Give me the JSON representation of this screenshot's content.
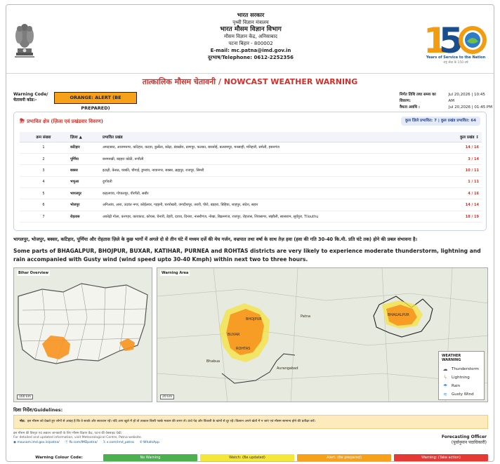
{
  "header": {
    "line1": "भारत सरकार",
    "line2": "पृथ्वी विज्ञान मंत्रालय",
    "line3": "भारत मौसम विज्ञान विभाग",
    "line4": "मौसम विज्ञान केंद्र, अनिसाबाद",
    "line5": "पटना बिहार - 800002",
    "line6": "E-mail: mc.patna@imd.gov.in",
    "line7": "दूरभाष/Telephone: 0612-2252356",
    "logo_number": "150",
    "logo_caption": "Years of Service to the Nation",
    "logo_caption_hi": "राष्ट्र सेवा के 150 वर्ष"
  },
  "title": "तात्कालिक मौसम चेतावनी / NOWCAST WEATHER WARNING",
  "warning": {
    "label_en": "Warning Code/",
    "label_hi": "चेतावनी कोड:-",
    "code": "ORANGE: ALERT (BE PREPARED)"
  },
  "issue": {
    "issued_label": "निर्गत तिथि तथा समय का विवरण:",
    "issued_value": "Jul 20,2026 | 10:45 AM",
    "valid_label": "वैधता अवधि :",
    "valid_value": "Jul 20,2026 | 01:45 PM"
  },
  "areas": {
    "heading": "प्रभावित क्षेत्र (ज़िला एवं प्रखंडवार विवरण)",
    "counts": "कुल ज़िले प्रभावित: 7 | कुल प्रखंड प्रभावित: 64",
    "columns": [
      "क्रम संख्या",
      "ज़िला ▲",
      "प्रभावित प्रखंड",
      "कुल प्रखंड ↕"
    ],
    "rows": [
      {
        "sn": "1",
        "district": "कटिहार",
        "blocks": "अमदाबाद, आजमनगर, कटिहार, कदवा, कुर्सेला, कोढ़ा, डंडखोरा, प्राणपुर, फलका, बारसोई, बलरामपुर, मनसाही, मनिहारी, समेली, हसनगंज",
        "total": "14 / 16"
      },
      {
        "sn": "2",
        "district": "पूर्णिया",
        "blocks": "बनमनखी, बड़हरा कोठी, रूपौली",
        "total": "3 / 14"
      },
      {
        "sn": "3",
        "district": "बक्सर",
        "blocks": "इटाढ़ी, केसठ, चक्की, चौगाई, डुमरांव, नावानगर, बक्सर, ब्रह्मपुर, राजपुर, सिमरी",
        "total": "10 / 11"
      },
      {
        "sn": "4",
        "district": "भभुआ",
        "blocks": "दुर्गावती",
        "total": "1 / 11"
      },
      {
        "sn": "5",
        "district": "भागलपुर",
        "blocks": "कहलगांव, गोपालपुर, पीरपैंती, सबौर",
        "total": "4 / 16"
      },
      {
        "sn": "6",
        "district": "भोजपुर",
        "blocks": "अगिआंव, आरा, उदवंत नगर, कोईलवर, गड़हनी, चरपोखरी, जगदीशपुर, तरारी, पीरो, बड़हरा, बिहिया, शाहपुर, संदेश, सहार",
        "total": "14 / 14"
      },
      {
        "sn": "7",
        "district": "रोहतास",
        "blocks": "अकोढ़ी गोला, करगहर, काराकाट, कोचस, चेनारी, डेहरी, दावथ, दिनारा, नासरीगंज, नोखा, बिक्रमगंज, राजपुर, रोहतास, शिवसागर, संझौली, सासाराम, सूर्यपुरा, Tilouthu",
        "total": "18 / 19"
      }
    ]
  },
  "message_hi": "भागलपुर, भोजपुर, बक्सर, कटिहार, पूर्णिया और रोहतास ज़िले के कुछ भागों में अगले दो से तीन घंटे में मध्यम दर्जे की मेघ गर्जन, वज्रपात तथा वर्षा के साथ तेज़ हवा (हवा की गति 30-40 कि.मी. प्रति घंटे तक) होने की प्रबल संभावना है।",
  "message_en": "Some parts of BHAGALPUR, BHOJPUR, BUXAR, KATIHAR, PURNEA and ROHTAS districts are very likely to experience moderate thunderstorm, lightning and rain accompanied with Gusty wind (wind speed upto 30-40 Kmph) within next two to three hours.",
  "maps": {
    "overview_title": "Bihar Overview",
    "overview_scale": "160 km",
    "area_title": "Warning Area",
    "area_scale": "20 km",
    "labels": [
      "BHOJPUR",
      "BUXAR",
      "ROHTAS",
      "BHAGALPUR",
      "Aurangabad",
      "Bhabua",
      "Patna"
    ],
    "legend_title": "WEATHER WARNING",
    "legend_items": [
      {
        "icon": "thunderstorm-icon",
        "label": "Thunderstorm"
      },
      {
        "icon": "lightning-icon",
        "label": "Lightning"
      },
      {
        "icon": "rain-icon",
        "label": "Rain"
      },
      {
        "icon": "gusty-wind-icon",
        "label": "Gusty Wind"
      }
    ]
  },
  "guidelines": {
    "heading": "दिशा निर्देश/Guidelines:",
    "note_label": "नोट:",
    "note": "इस मौसम को देखते हुए लोगों से आग्रह है कि वे सतर्क और सावधान रहें। यदि आप खुले में हों तो तत्काल किसी पक्के मकान की शरण लें। ऊंचे पेड़ और बिजली के खंभों से दूर रहें। किसान अपने खेतों में न जाएं एवं मौसम सामान्य होने की प्रतीक्षा करें।"
  },
  "footer": {
    "info_hi": "इस मौसम की विस्तृत एवं अद्यतन जानकारी के लिए मौसम विज्ञान केंद्र, पटना की वेबसाइट देखें।",
    "info_en": "For detailed and updated information, visit Meteorological Centre, Patna website.",
    "links": [
      "mausam.imd.gov.in/patna/",
      "fb.com/IMDpatna/",
      "x.com/imd_patna",
      "WhatsApp"
    ],
    "officer_en": "Forecasting Officer",
    "officer_hi": "(पूर्वानुमान पदाधिकारी)",
    "colour_code_label": "Warning Colour Code:",
    "colour_codes": [
      {
        "label": "No Warning",
        "color": "#4caf50"
      },
      {
        "label": "Watch: (Be updated)",
        "color": "#f5e63a"
      },
      {
        "label": "Alert: (Be prepared)",
        "color": "#f7a11b"
      },
      {
        "label": "Warning: (Take action)",
        "color": "#e53935"
      }
    ]
  }
}
